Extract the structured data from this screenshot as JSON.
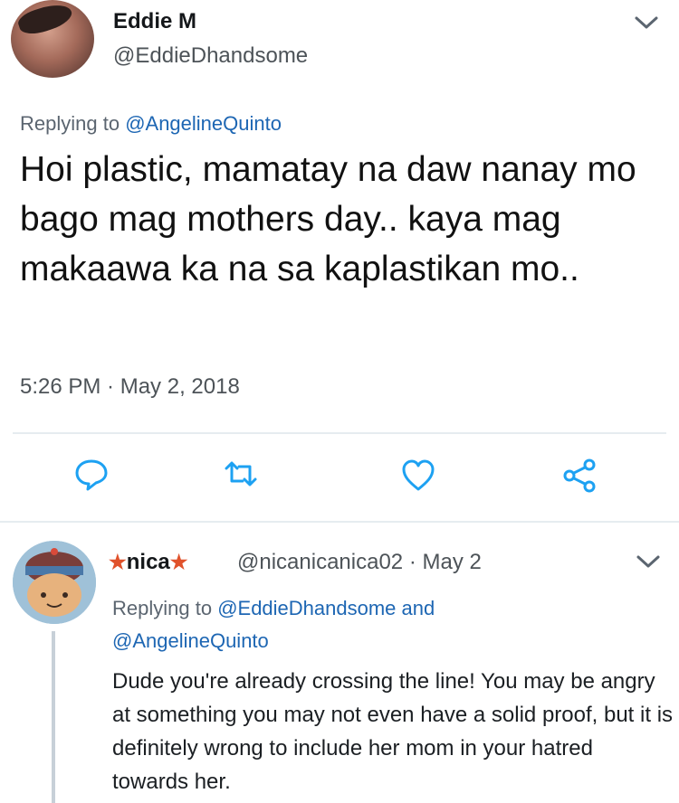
{
  "tweet": {
    "author_name": "Eddie M",
    "author_handle": "@EddieDhandsome",
    "replying_prefix": "Replying to ",
    "replying_mention": "@AngelineQuinto",
    "text": "Hoi plastic, mamatay na daw nanay mo bago mag mothers day.. kaya mag makaawa ka na sa kaplastikan mo..",
    "timestamp": "5:26 PM · May 2, 2018",
    "actions": {
      "reply_icon": "speech-bubble-icon",
      "retweet_icon": "retweet-icon",
      "like_icon": "heart-icon",
      "share_icon": "share-icon"
    }
  },
  "reply": {
    "author_name": "nica",
    "author_handle": "@nicanicanica02",
    "date": "· May 2",
    "replying_prefix": "Replying to ",
    "replying_mention1": "@EddieDhandsome",
    "replying_and": " and",
    "replying_mention2": "@AngelineQuinto",
    "text": "Dude you're already crossing the line! You may be angry at something you may not even have a solid proof, but it is definitely wrong to include her mom in your hatred towards her."
  },
  "colors": {
    "link": "#1d66b3",
    "icon": "#1da1f2",
    "muted": "#4d5358"
  }
}
